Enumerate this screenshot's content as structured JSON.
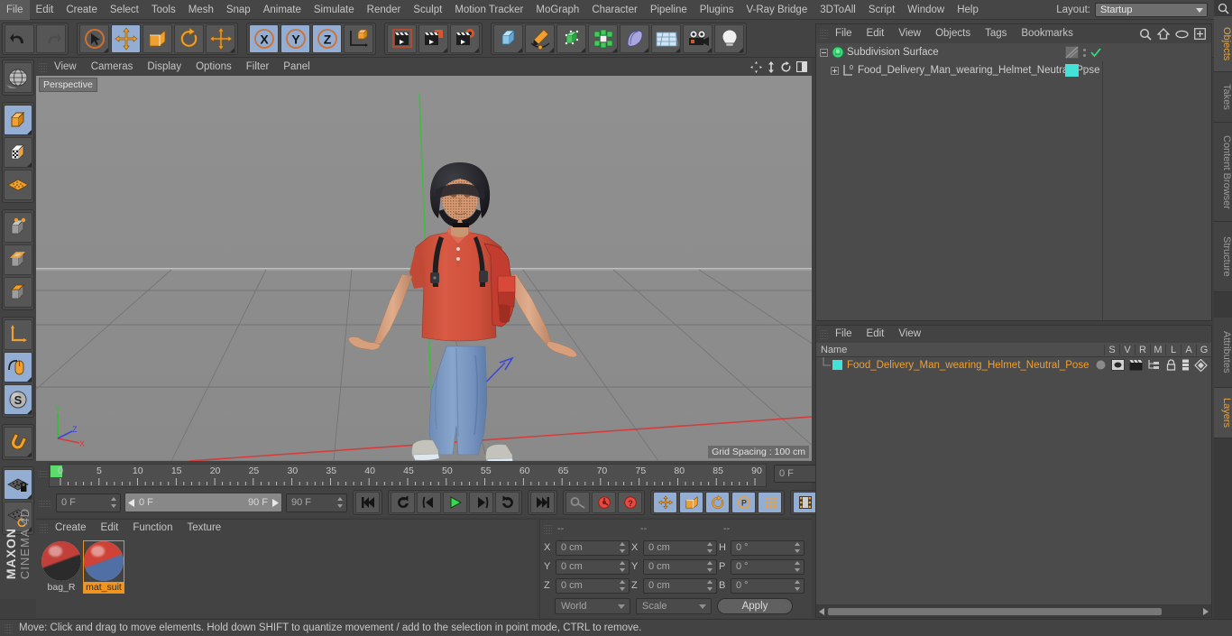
{
  "app": {
    "brand_line1": "MAXON",
    "brand_line2": "CINEMA 4D"
  },
  "menubar": {
    "items": [
      "File",
      "Edit",
      "Create",
      "Select",
      "Tools",
      "Mesh",
      "Snap",
      "Animate",
      "Simulate",
      "Render",
      "Sculpt",
      "Motion Tracker",
      "MoGraph",
      "Character",
      "Pipeline",
      "Plugins",
      "V-Ray Bridge",
      "3DToAll",
      "Script",
      "Window",
      "Help"
    ],
    "layout_label": "Layout:",
    "layout_value": "Startup",
    "search_icon": "search-icon"
  },
  "toolbar": {
    "groups": [
      {
        "name": "undo-redo",
        "buttons": [
          {
            "name": "undo-button",
            "icon": "undo-arrow-icon",
            "active": false
          },
          {
            "name": "redo-button",
            "icon": "redo-arrow-icon",
            "active": false,
            "disabled": true
          }
        ]
      },
      {
        "name": "transform-tools",
        "buttons": [
          {
            "name": "live-selection-tool",
            "icon": "cursor-circle-icon",
            "active": false
          },
          {
            "name": "move-tool",
            "icon": "move-cross-icon",
            "active": true
          },
          {
            "name": "scale-tool",
            "icon": "scale-box-icon",
            "active": false
          },
          {
            "name": "rotate-tool",
            "icon": "rotate-arc-icon",
            "active": false
          },
          {
            "name": "dynamic-place-tool",
            "icon": "move-cross-icon",
            "active": false
          }
        ]
      },
      {
        "name": "axis-locks",
        "buttons": [
          {
            "name": "x-axis-lock",
            "icon": "x-axis-icon",
            "active": true,
            "label": "X"
          },
          {
            "name": "y-axis-lock",
            "icon": "y-axis-icon",
            "active": true,
            "label": "Y"
          },
          {
            "name": "z-axis-lock",
            "icon": "z-axis-icon",
            "active": true,
            "label": "Z"
          },
          {
            "name": "world-object-coordinates",
            "icon": "world-axis-cube-icon",
            "active": false
          }
        ]
      },
      {
        "name": "render-tools",
        "buttons": [
          {
            "name": "render-view-button",
            "icon": "clapperboard-view-icon",
            "active": false
          },
          {
            "name": "render-to-picture-viewer-button",
            "icon": "clapperboard-picture-icon",
            "active": false
          },
          {
            "name": "render-settings-button",
            "icon": "clapperboard-gear-icon",
            "active": false
          }
        ]
      },
      {
        "name": "create-objects",
        "buttons": [
          {
            "name": "add-primitive-cube-button",
            "icon": "blue-cube-icon",
            "active": false
          },
          {
            "name": "add-spline-pen-button",
            "icon": "pen-spline-icon",
            "active": false
          },
          {
            "name": "add-generator-button",
            "icon": "green-cube-generator-icon",
            "active": false
          },
          {
            "name": "add-modeling-object-button",
            "icon": "green-array-icon",
            "active": false
          },
          {
            "name": "add-deformer-button",
            "icon": "bend-deformer-icon",
            "active": false
          },
          {
            "name": "add-environment-button",
            "icon": "floor-grid-icon",
            "active": false
          },
          {
            "name": "add-camera-button",
            "icon": "camera-icon",
            "active": false
          },
          {
            "name": "add-light-button",
            "icon": "lightbulb-icon",
            "active": false
          }
        ]
      }
    ]
  },
  "left_toolbar": {
    "groups": [
      {
        "name": "world-mode",
        "buttons": [
          {
            "name": "make-editable-globe-button",
            "icon": "globe-wire-icon",
            "active": false
          }
        ]
      },
      {
        "name": "mode-group-1",
        "buttons": [
          {
            "name": "model-mode-button",
            "icon": "orange-cube-model-icon",
            "active": true
          },
          {
            "name": "texture-mode-button",
            "icon": "checker-cube-texture-icon",
            "active": false
          },
          {
            "name": "workplane-mode-button",
            "icon": "orange-plane-grid-icon",
            "active": false
          }
        ]
      },
      {
        "name": "component-modes",
        "buttons": [
          {
            "name": "points-mode-button",
            "icon": "points-cube-icon",
            "active": false
          },
          {
            "name": "edges-mode-button",
            "icon": "edges-cube-icon",
            "active": false
          },
          {
            "name": "polygons-mode-button",
            "icon": "polygons-cube-icon",
            "active": false
          }
        ]
      },
      {
        "name": "axis-group",
        "buttons": [
          {
            "name": "enable-axis-button",
            "icon": "axis-L-icon",
            "active": false
          },
          {
            "name": "viewport-solo-button",
            "icon": "mouse-icon",
            "active": true
          },
          {
            "name": "soft-selection-button",
            "icon": "s-sphere-icon",
            "active": true
          }
        ]
      },
      {
        "name": "snap-group",
        "buttons": [
          {
            "name": "enable-snap-button",
            "icon": "magnet-icon",
            "active": false
          }
        ]
      },
      {
        "name": "workplane-group",
        "buttons": [
          {
            "name": "lock-workplane-button",
            "icon": "grid-lock-icon",
            "active": true
          },
          {
            "name": "planar-workplane-button",
            "icon": "grid-rotate-icon",
            "active": false
          }
        ]
      }
    ]
  },
  "viewport": {
    "menu_items": [
      "View",
      "Cameras",
      "Display",
      "Filter",
      "Options",
      "Panel"
    ],
    "menu_order": [
      "View",
      "Cameras",
      "Display",
      "Options",
      "Filter",
      "Panel"
    ],
    "label": "Perspective",
    "grid_spacing": "Grid Spacing : 100 cm",
    "axis_gizmo": {
      "x": "X",
      "y": "Y",
      "z": "Z"
    },
    "corner_icons": [
      "pan-icon",
      "zoom-icon",
      "rotate-icon",
      "maximize-icon"
    ]
  },
  "timeline": {
    "ruler_labels": [
      "0",
      "5",
      "10",
      "15",
      "20",
      "25",
      "30",
      "35",
      "40",
      "45",
      "50",
      "55",
      "60",
      "65",
      "70",
      "75",
      "80",
      "85",
      "90"
    ],
    "current_frame_right": "0 F",
    "current_frame_field": "0 F",
    "range_start": "0 F",
    "range_end": "90 F",
    "end_frame_field": "90 F",
    "playback_buttons": [
      {
        "name": "go-to-start-button",
        "icon": "skip-start-icon"
      },
      {
        "name": "play-backwards-loop-button",
        "icon": "loop-back-icon"
      },
      {
        "name": "previous-frame-button",
        "icon": "step-back-icon"
      },
      {
        "name": "play-button",
        "icon": "play-icon"
      },
      {
        "name": "next-frame-button",
        "icon": "step-forward-icon"
      },
      {
        "name": "play-forwards-loop-button",
        "icon": "loop-forward-icon"
      },
      {
        "name": "go-to-end-button",
        "icon": "skip-end-icon"
      }
    ],
    "key_buttons": [
      {
        "name": "record-active-objects-button",
        "icon": "key-icon"
      },
      {
        "name": "autokeying-button",
        "icon": "red-circle-record-icon"
      },
      {
        "name": "keyframe-selection-button",
        "icon": "red-question-icon"
      }
    ],
    "record_toggles": [
      {
        "name": "position-key-button",
        "icon": "move-cross-icon",
        "active": true
      },
      {
        "name": "scale-key-button",
        "icon": "scale-box-icon",
        "active": true
      },
      {
        "name": "rotation-key-button",
        "icon": "rotate-arc-icon",
        "active": true
      },
      {
        "name": "pla-key-button",
        "icon": "p-circle-icon",
        "active": true
      },
      {
        "name": "param-key-button",
        "icon": "dots-grid-icon",
        "active": true
      }
    ],
    "last_button": {
      "name": "timeline-layout-button",
      "icon": "film-strip-icon",
      "active": true
    }
  },
  "materials": {
    "menu_items": [
      "Create",
      "Edit",
      "Function",
      "Texture"
    ],
    "items": [
      {
        "name": "bag_R",
        "selected": false,
        "color_top": "#c1403a",
        "color_bottom": "#2b2b2b"
      },
      {
        "name": "mat_suit",
        "selected": true,
        "color_top": "#cf4237",
        "color_bottom": "#4f6fa5"
      }
    ]
  },
  "coordinates": {
    "header": [
      "--",
      "--",
      "--"
    ],
    "rows": [
      {
        "pos_label": "X",
        "pos_value": "0 cm",
        "size_label": "X",
        "size_value": "0 cm",
        "rot_label": "H",
        "rot_value": "0 °"
      },
      {
        "pos_label": "Y",
        "pos_value": "0 cm",
        "size_label": "Y",
        "size_value": "0 cm",
        "rot_label": "P",
        "rot_value": "0 °"
      },
      {
        "pos_label": "Z",
        "pos_value": "0 cm",
        "size_label": "Z",
        "size_value": "0 cm",
        "rot_label": "B",
        "rot_value": "0 °"
      }
    ],
    "coord_system": "World",
    "transform_mode": "Scale",
    "apply_label": "Apply"
  },
  "object_manager": {
    "menu_items": [
      "File",
      "Edit",
      "View",
      "Objects",
      "Tags",
      "Bookmarks"
    ],
    "header_icons": [
      "search-icon",
      "home-icon",
      "eye-icon",
      "plus-box-icon"
    ],
    "rows": [
      {
        "name": "Subdivision Surface",
        "icon": "subdivision-surface-icon",
        "indent": 0,
        "expanded": true,
        "tag_color": "",
        "check": true
      },
      {
        "name": "Food_Delivery_Man_wearing_Helmet_Neutral_Pose",
        "icon": "null-object-icon",
        "indent": 1,
        "expanded": false,
        "tag_color": "#45e0d8",
        "check": false
      }
    ]
  },
  "layer_manager": {
    "menu_items": [
      "File",
      "Edit",
      "View"
    ],
    "column_name": "Name",
    "columns": [
      "S",
      "V",
      "R",
      "M",
      "L",
      "A",
      "G"
    ],
    "rows": [
      {
        "name": "Food_Delivery_Man_wearing_Helmet_Neutral_Pose",
        "swatch": "#45e0d8"
      }
    ]
  },
  "right_tabs": [
    {
      "label": "Objects",
      "active": true
    },
    {
      "label": "Takes",
      "active": false
    },
    {
      "label": "Content Browser",
      "active": false
    },
    {
      "label": "Structure",
      "active": false
    },
    {
      "label": "Attributes",
      "active": false
    },
    {
      "label": "Layers",
      "active": true
    }
  ],
  "status_bar": {
    "message": "Move: Click and drag to move elements. Hold down SHIFT to quantize movement / add to the selection in point mode, CTRL to remove."
  },
  "colors": {
    "accent_orange": "#f0a030",
    "active_blue": "#93aed2",
    "panel_bg": "#434343",
    "viewport_bg": "#8d8d8d",
    "shirt_red": "#d4503f",
    "pants_blue": "#7f9cc4",
    "teal_tag": "#45e0d8"
  }
}
